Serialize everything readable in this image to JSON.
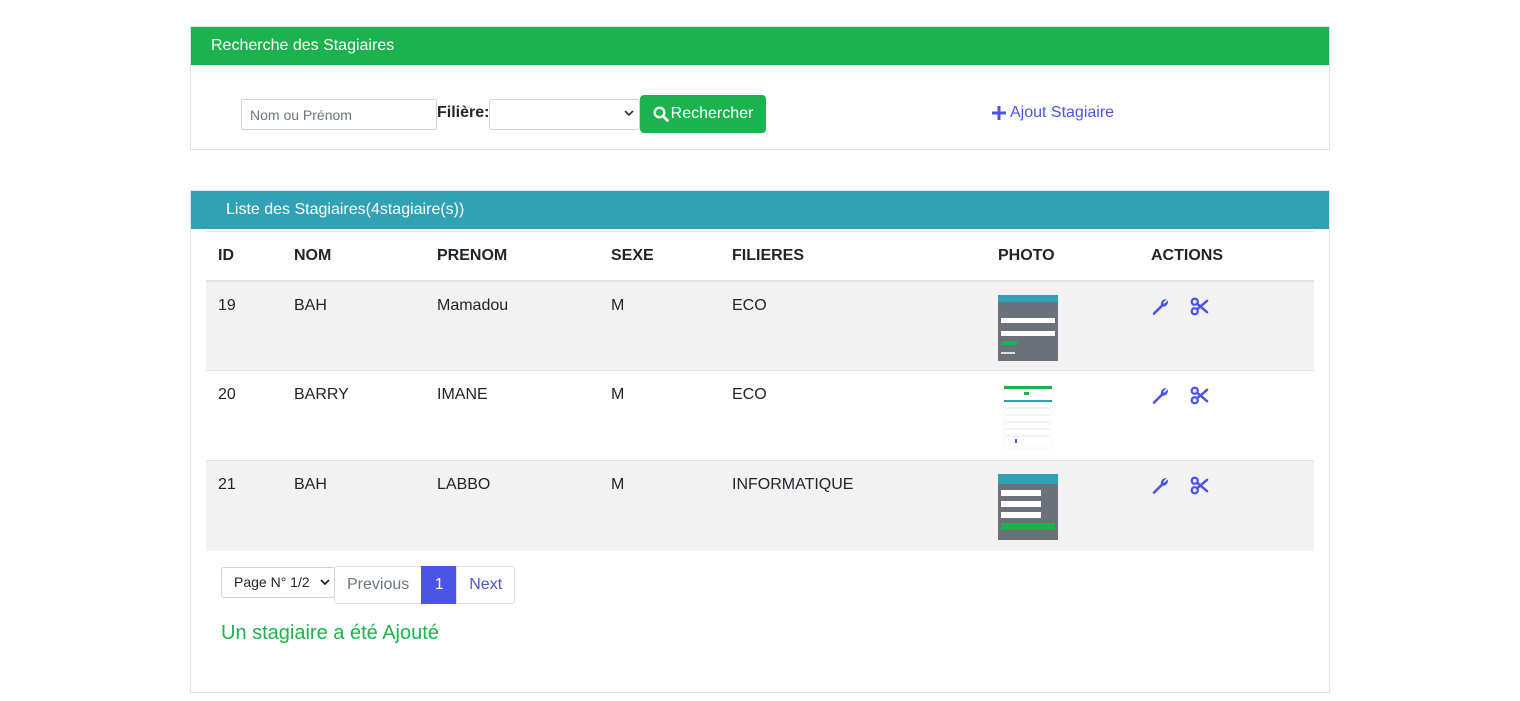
{
  "search": {
    "title": "Recherche des Stagiaires",
    "placeholder": "Nom ou Prénom",
    "filiere_label": "Filière:",
    "filiere_selected": "",
    "button_label": "Rechercher",
    "add_label": "Ajout Stagiaire"
  },
  "list": {
    "title": "Liste des Stagiaires(4stagiaire(s))",
    "headers": [
      "ID",
      "NOM",
      "PRENOM",
      "SEXE",
      "FILIERES",
      "PHOTO",
      "ACTIONS"
    ],
    "rows": [
      {
        "id": "19",
        "nom": "BAH",
        "prenom": "Mamadou",
        "sexe": "M",
        "filiere": "ECO"
      },
      {
        "id": "20",
        "nom": "BARRY",
        "prenom": "IMANE",
        "sexe": "M",
        "filiere": "ECO"
      },
      {
        "id": "21",
        "nom": "BAH",
        "prenom": "LABBO",
        "sexe": "M",
        "filiere": "INFORMATIQUE"
      }
    ]
  },
  "pagination": {
    "page_select": "Page N° 1/2",
    "previous": "Previous",
    "current": "1",
    "next": "Next"
  },
  "message": "Un stagiaire a été Ajouté",
  "colors": {
    "green": "#1cb34e",
    "teal": "#31a1b6",
    "link": "#4c54e6"
  },
  "icons": {
    "search": "search-icon",
    "add": "plus-icon",
    "edit": "wrench-icon",
    "delete": "scissors-icon"
  }
}
